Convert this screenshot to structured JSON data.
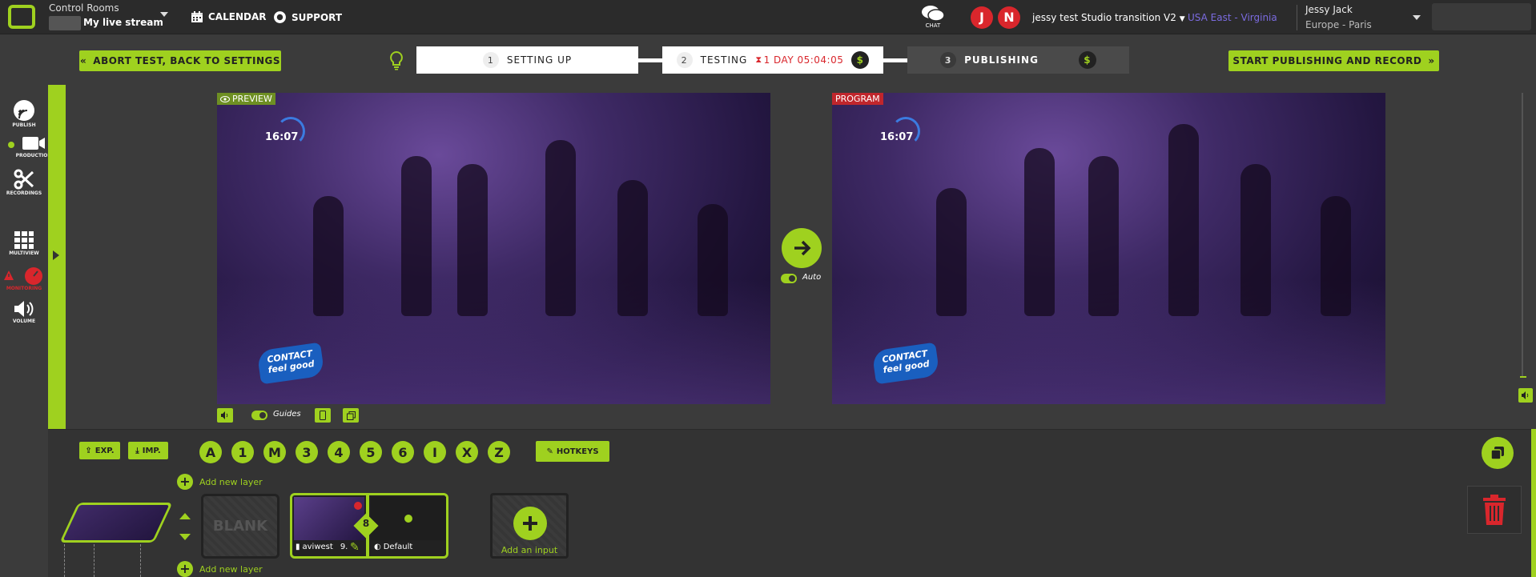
{
  "header": {
    "control_rooms_label": "Control Rooms",
    "stream_name": "My live stream",
    "nav": [
      {
        "label": "CALENDAR",
        "icon": "calendar-icon"
      },
      {
        "label": "SUPPORT",
        "icon": "support-icon"
      }
    ],
    "chat_label": "CHAT",
    "avatars": [
      "J",
      "N"
    ],
    "studio_name": "jessy test Studio transition V2",
    "region": "USA East - Virginia",
    "user_name": "Jessy Jack",
    "user_timezone": "Europe - Paris"
  },
  "workflow": {
    "abort_label": "ABORT TEST, BACK TO SETTINGS",
    "steps": [
      {
        "num": "1",
        "label": "SETTING UP"
      },
      {
        "num": "2",
        "label": "TESTING",
        "timer": "1 DAY 05:04:05"
      },
      {
        "num": "3",
        "label": "PUBLISHING"
      }
    ],
    "dollar_symbol": "$",
    "start_label": "START PUBLISHING AND RECORD"
  },
  "sidebar": {
    "items": [
      {
        "label": "PUBLISH",
        "icon": "publish-icon"
      },
      {
        "label": "PRODUCTION",
        "icon": "production-icon"
      },
      {
        "label": "RECORDINGS",
        "icon": "recordings-icon"
      },
      {
        "label": "MULTIVIEW",
        "icon": "multiview-icon"
      },
      {
        "label": "MONITORING",
        "icon": "monitoring-icon"
      },
      {
        "label": "VOLUME",
        "icon": "volume-icon"
      }
    ]
  },
  "preview": {
    "label": "PREVIEW",
    "clock": "16:07",
    "brand_line1": "CONTACT",
    "brand_line2": "feel good"
  },
  "program": {
    "label": "PROGRAM",
    "clock": "16:07",
    "brand_line1": "CONTACT",
    "brand_line2": "feel good"
  },
  "transition": {
    "auto_label": "Auto"
  },
  "preview_controls": {
    "guides_label": "Guides"
  },
  "bottom": {
    "export_label": "EXP.",
    "import_label": "IMP.",
    "hotkey_keys": [
      "A",
      "1",
      "M",
      "3",
      "4",
      "5",
      "6",
      "I",
      "X",
      "Z"
    ],
    "hotkeys_label": "HOTKEYS",
    "add_layer_label": "Add new layer",
    "blank_label": "BLANK",
    "scene_input_name": "aviwest",
    "scene_input_suffix": "9.",
    "scene_layout_label": "Default",
    "scene_badge": "8",
    "add_input_label": "Add an input"
  },
  "colors": {
    "accent": "#9fd11f",
    "danger": "#d9262c",
    "region": "#7b6be0"
  }
}
